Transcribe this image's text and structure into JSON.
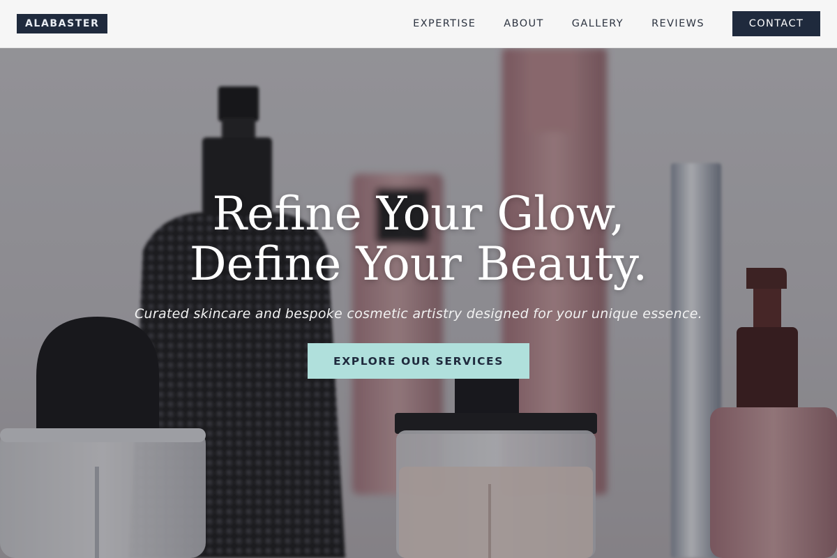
{
  "brand": {
    "logo_text": "ALABASTER"
  },
  "nav": {
    "links": [
      {
        "label": "EXPERTISE"
      },
      {
        "label": "ABOUT"
      },
      {
        "label": "GALLERY"
      },
      {
        "label": "REVIEWS"
      }
    ],
    "cta_label": "CONTACT"
  },
  "hero": {
    "title_line1": "Refine Your Glow,",
    "title_line2": "Define Your Beauty.",
    "subtitle": "Curated skincare and bespoke cosmetic artistry designed for your unique essence.",
    "cta_label": "EXPLORE OUR SERVICES",
    "background_image": "cosmetic-bottles-photo"
  },
  "colors": {
    "navy": "#1f2a3d",
    "mint": "#b0e0dc",
    "header_bg": "#f6f6f6"
  }
}
